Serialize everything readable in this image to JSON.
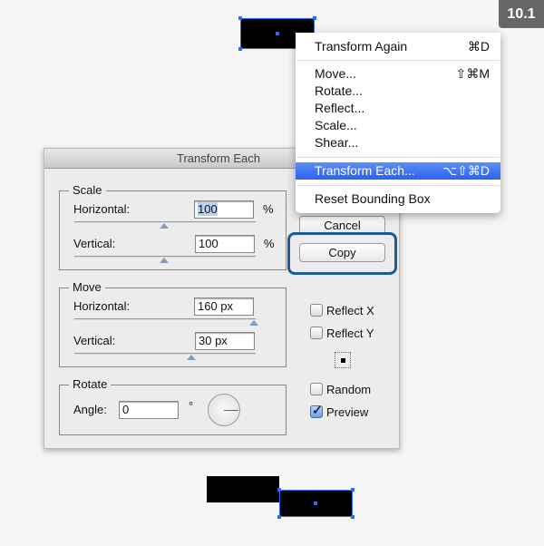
{
  "badge": "10.1",
  "menu": {
    "items": [
      {
        "label": "Transform Again",
        "shortcut": "⌘D"
      },
      {
        "label": "Move...",
        "shortcut": "⇧⌘M"
      },
      {
        "label": "Rotate...",
        "shortcut": ""
      },
      {
        "label": "Reflect...",
        "shortcut": ""
      },
      {
        "label": "Scale...",
        "shortcut": ""
      },
      {
        "label": "Shear...",
        "shortcut": ""
      },
      {
        "label": "Transform Each...",
        "shortcut": "⌥⇧⌘D",
        "highlighted": true
      },
      {
        "label": "Reset Bounding Box",
        "shortcut": ""
      }
    ]
  },
  "dialog": {
    "title": "Transform Each",
    "scale": {
      "legend": "Scale",
      "h_label": "Horizontal:",
      "h_value": "100",
      "h_unit": "%",
      "v_label": "Vertical:",
      "v_value": "100",
      "v_unit": "%"
    },
    "move": {
      "legend": "Move",
      "h_label": "Horizontal:",
      "h_value": "160 px",
      "v_label": "Vertical:",
      "v_value": "30 px"
    },
    "rotate": {
      "legend": "Rotate",
      "angle_label": "Angle:",
      "angle_value": "0",
      "unit": "°"
    },
    "buttons": {
      "cancel": "Cancel",
      "copy": "Copy"
    },
    "options": [
      {
        "label": "Reflect X",
        "checked": false
      },
      {
        "label": "Reflect Y",
        "checked": false
      },
      {
        "label": "Random",
        "checked": false
      },
      {
        "label": "Preview",
        "checked": true
      }
    ],
    "highlight_color": "#1f5a96",
    "selection_color": "#2a6cf0"
  }
}
